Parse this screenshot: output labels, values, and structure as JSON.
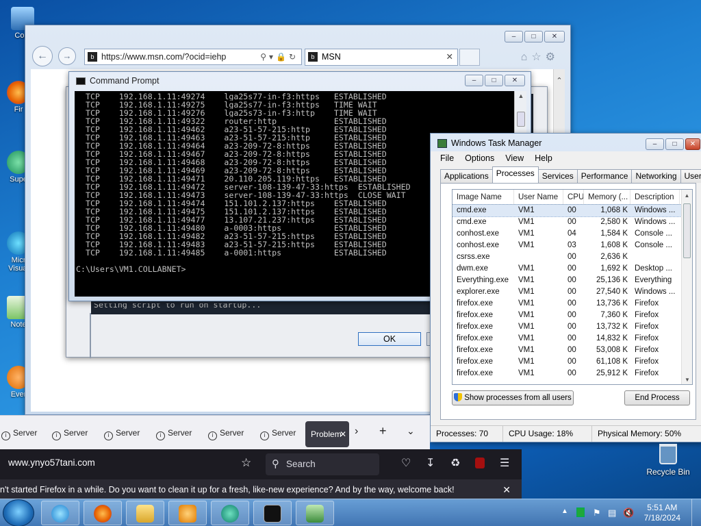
{
  "desktop": {
    "icons": [
      "Com",
      "Fir",
      "Supe",
      "Micr",
      "Visual",
      "Note",
      "Ever"
    ],
    "recycle_bin": "Recycle Bin"
  },
  "ie": {
    "address": "https://www.msn.com/?ocid=iehp",
    "tab_title": "MSN"
  },
  "dialog": {
    "ok_label": "OK",
    "partial_text": "Setting script to run on startup..."
  },
  "cmd": {
    "title": "Command Prompt",
    "lines": [
      "  TCP    192.168.1.11:49274    lga25s77-in-f3:https   ESTABLISHED",
      "  TCP    192.168.1.11:49275    lga25s77-in-f3:https   TIME_WAIT",
      "  TCP    192.168.1.11:49276    lga25s73-in-f3:http    TIME_WAIT",
      "  TCP    192.168.1.11:49322    router:http            ESTABLISHED",
      "  TCP    192.168.1.11:49462    a23-51-57-215:http     ESTABLISHED",
      "  TCP    192.168.1.11:49463    a23-51-57-215:http     ESTABLISHED",
      "  TCP    192.168.1.11:49464    a23-209-72-8:https     ESTABLISHED",
      "  TCP    192.168.1.11:49467    a23-209-72-8:https     ESTABLISHED",
      "  TCP    192.168.1.11:49468    a23-209-72-8:https     ESTABLISHED",
      "  TCP    192.168.1.11:49469    a23-209-72-8:https     ESTABLISHED",
      "  TCP    192.168.1.11:49471    20.110.205.119:https   ESTABLISHED",
      "  TCP    192.168.1.11:49472    server-108-139-47-33:https  ESTABLISHED",
      "  TCP    192.168.1.11:49473    server-108-139-47-33:https  CLOSE_WAIT",
      "  TCP    192.168.1.11:49474    151.101.2.137:https    ESTABLISHED",
      "  TCP    192.168.1.11:49475    151.101.2.137:https    ESTABLISHED",
      "  TCP    192.168.1.11:49477    13.107.21.237:https    ESTABLISHED",
      "  TCP    192.168.1.11:49480    a-0003:https           ESTABLISHED",
      "  TCP    192.168.1.11:49482    a23-51-57-215:https    ESTABLISHED",
      "  TCP    192.168.1.11:49483    a23-51-57-215:https    ESTABLISHED",
      "  TCP    192.168.1.11:49485    a-0001:https           ESTABLISHED",
      "",
      "C:\\Users\\VM1.COLLABNET>"
    ]
  },
  "taskmgr": {
    "title": "Windows Task Manager",
    "menu": [
      "File",
      "Options",
      "View",
      "Help"
    ],
    "tabs": [
      "Applications",
      "Processes",
      "Services",
      "Performance",
      "Networking",
      "Users"
    ],
    "active_tab": "Processes",
    "columns": [
      "Image Name",
      "User Name",
      "CPU",
      "Memory (...",
      "Description"
    ],
    "processes": [
      [
        "cmd.exe",
        "VM1",
        "00",
        "1,068 K",
        "Windows ..."
      ],
      [
        "cmd.exe",
        "VM1",
        "00",
        "2,580 K",
        "Windows ..."
      ],
      [
        "conhost.exe",
        "VM1",
        "04",
        "1,584 K",
        "Console ..."
      ],
      [
        "conhost.exe",
        "VM1",
        "03",
        "1,608 K",
        "Console ..."
      ],
      [
        "csrss.exe",
        "",
        "00",
        "2,636 K",
        ""
      ],
      [
        "dwm.exe",
        "VM1",
        "00",
        "1,692 K",
        "Desktop ..."
      ],
      [
        "Everything.exe",
        "VM1",
        "00",
        "25,136 K",
        "Everything"
      ],
      [
        "explorer.exe",
        "VM1",
        "00",
        "27,540 K",
        "Windows ..."
      ],
      [
        "firefox.exe",
        "VM1",
        "00",
        "13,736 K",
        "Firefox"
      ],
      [
        "firefox.exe",
        "VM1",
        "00",
        "7,360 K",
        "Firefox"
      ],
      [
        "firefox.exe",
        "VM1",
        "00",
        "13,732 K",
        "Firefox"
      ],
      [
        "firefox.exe",
        "VM1",
        "00",
        "14,832 K",
        "Firefox"
      ],
      [
        "firefox.exe",
        "VM1",
        "00",
        "53,008 K",
        "Firefox"
      ],
      [
        "firefox.exe",
        "VM1",
        "00",
        "61,108 K",
        "Firefox"
      ],
      [
        "firefox.exe",
        "VM1",
        "00",
        "25,912 K",
        "Firefox"
      ]
    ],
    "show_all_label": "Show processes from all users",
    "end_process_label": "End Process",
    "status": {
      "processes": "Processes: 70",
      "cpu": "CPU Usage: 18%",
      "memory": "Physical Memory: 50%"
    }
  },
  "firefox": {
    "tabs": [
      "Server",
      "Server",
      "Server",
      "Server",
      "Server",
      "Server"
    ],
    "active_tab": "Problem",
    "url": "www.ynyo57tani.com",
    "search_placeholder": "Search",
    "notification": "n't started Firefox in a while. Do you want to clean it up for a fresh, like-new experience? And by the way, welcome back!"
  },
  "taskbar": {
    "time": "5:51 AM",
    "date": "7/18/2024"
  }
}
